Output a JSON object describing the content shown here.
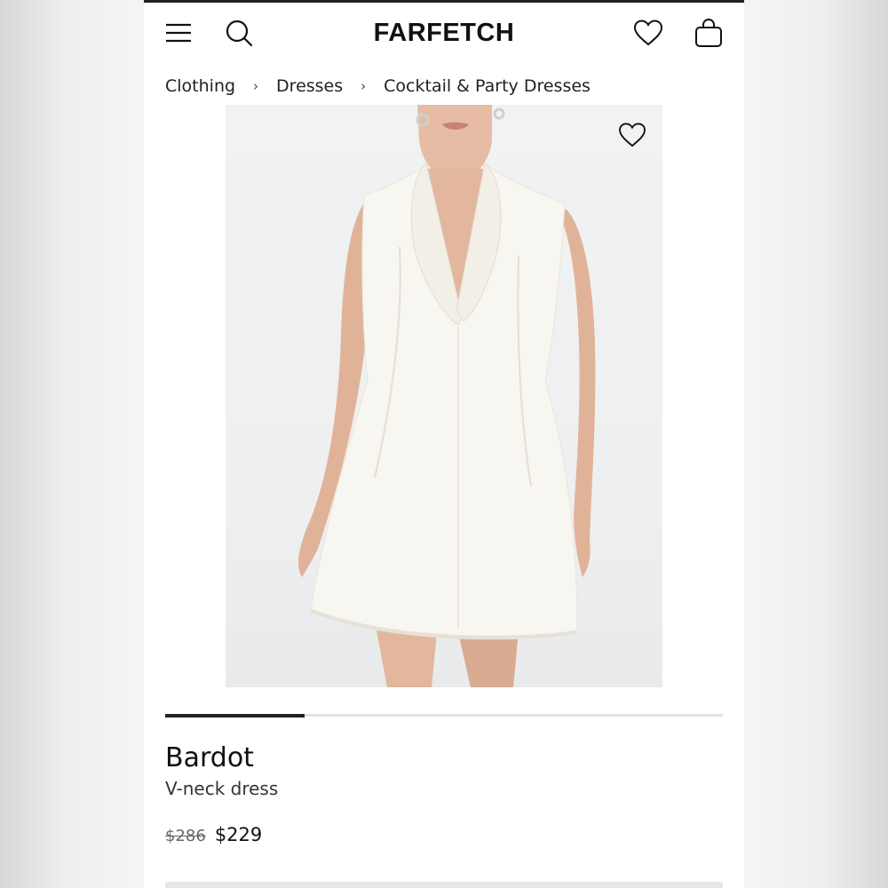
{
  "header": {
    "brand": "FARFETCH",
    "icons": [
      "menu-icon",
      "search-icon",
      "heart-icon",
      "bag-icon"
    ]
  },
  "breadcrumb": {
    "items": [
      "Clothing",
      "Dresses",
      "Cocktail & Party Dresses"
    ],
    "separator": "›"
  },
  "gallery": {
    "image_index_progress": 0.25
  },
  "product": {
    "brand": "Bardot",
    "description": "V-neck dress",
    "original_price": "$286",
    "sale_price": "$229"
  },
  "colors": {
    "text": "#111111",
    "dress": "#f7f5ef",
    "skin": "#e2b79d"
  }
}
